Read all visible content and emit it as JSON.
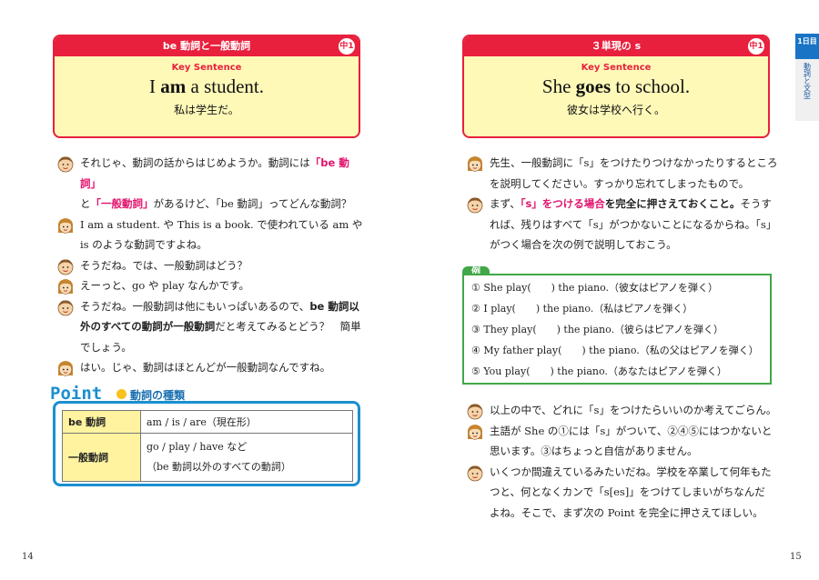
{
  "left": {
    "key": {
      "bar_title": "be 動詞と一般動詞",
      "badge": "中1",
      "label": "Key Sentence",
      "sentence_pre": "I ",
      "sentence_bold": "am",
      "sentence_post": " a student.",
      "translation": "私は学生だ。"
    },
    "dialog": {
      "l1a": "それじゃ、動詞の話からはじめようか。動詞には",
      "l1b": "「be 動詞」",
      "l1c": "と",
      "l1d": "「一般動詞」",
      "l1e": "があるけど、「be 動詞」ってどんな動詞？",
      "l2a": "I am a student. や This is a book. で使われている am や",
      "l2b": "is のような動詞ですよね。",
      "l3": "そうだね。では、一般動詞はどう？",
      "l4": "えーっと、go や play なんかです。",
      "l5a": "そうだね。一般動詞は他にもいっぱいあるので、",
      "l5b": "be 動詞以",
      "l5c": "外のすべての動詞が一般動詞",
      "l5d": "だと考えてみるとどう？　簡単",
      "l5e": "でしょう。",
      "l6": "はい。じゃ、動詞はほとんどが一般動詞なんですね。"
    },
    "point": {
      "title": "Point",
      "subtitle": "動詞の種類",
      "rows": [
        {
          "head": "be 動詞",
          "body1": "am / is / are（現在形）",
          "body2": ""
        },
        {
          "head": "一般動詞",
          "body1": "go / play / have など",
          "body2": "（be 動詞以外のすべての動詞）"
        }
      ]
    },
    "page_number": "14"
  },
  "right": {
    "key": {
      "bar_title": "３単現の s",
      "badge": "中1",
      "label": "Key Sentence",
      "sentence_pre": "She ",
      "sentence_bold": "goes",
      "sentence_post": " to school.",
      "translation": "彼女は学校へ行く。"
    },
    "dialog": {
      "l1a": "先生、一般動詞に「s」をつけたりつけなかったりするところ",
      "l1b": "を説明してください。すっかり忘れてしまったもので。",
      "l2a": "まず、",
      "l2b": "「s」をつける場合",
      "l2c": "を完全に押さえておくこと。",
      "l2d": "そうす",
      "l2e": "れば、残りはすべて「s」がつかないことになるからね。「s」",
      "l2f": "がつく場合を次の例で説明しておこう。",
      "l3": "以上の中で、どれに「s」をつけたらいいのか考えてごらん。",
      "l4a": "主語が She の①には「s」がついて、②④⑤にはつかないと",
      "l4b": "思います。③はちょっと自信がありません。",
      "l5a": "いくつか間違えているみたいだね。学校を卒業して何年もた",
      "l5b": "つと、何となくカンで「s[es]」をつけてしまいがちなんだ",
      "l5c": "よね。そこで、まず次の Point を完全に押さえてほしい。"
    },
    "example": {
      "tag": "例",
      "items": [
        "① She play(　　) the piano.（彼女はピアノを弾く）",
        "② I play(　　) the piano.（私はピアノを弾く）",
        "③ They play(　　) the piano.（彼らはピアノを弾く）",
        "④ My father play(　　) the piano.（私の父はピアノを弾く）",
        "⑤ You play(　　) the piano.（あなたはピアノを弾く）"
      ]
    },
    "page_number": "15"
  },
  "sidetab": {
    "day": "1日目",
    "title": "動詞と文型"
  },
  "colors": {
    "accent_red": "#e8203d",
    "key_bg": "#fff9b8",
    "point_blue": "#1a8fd0",
    "example_green": "#42a748"
  }
}
